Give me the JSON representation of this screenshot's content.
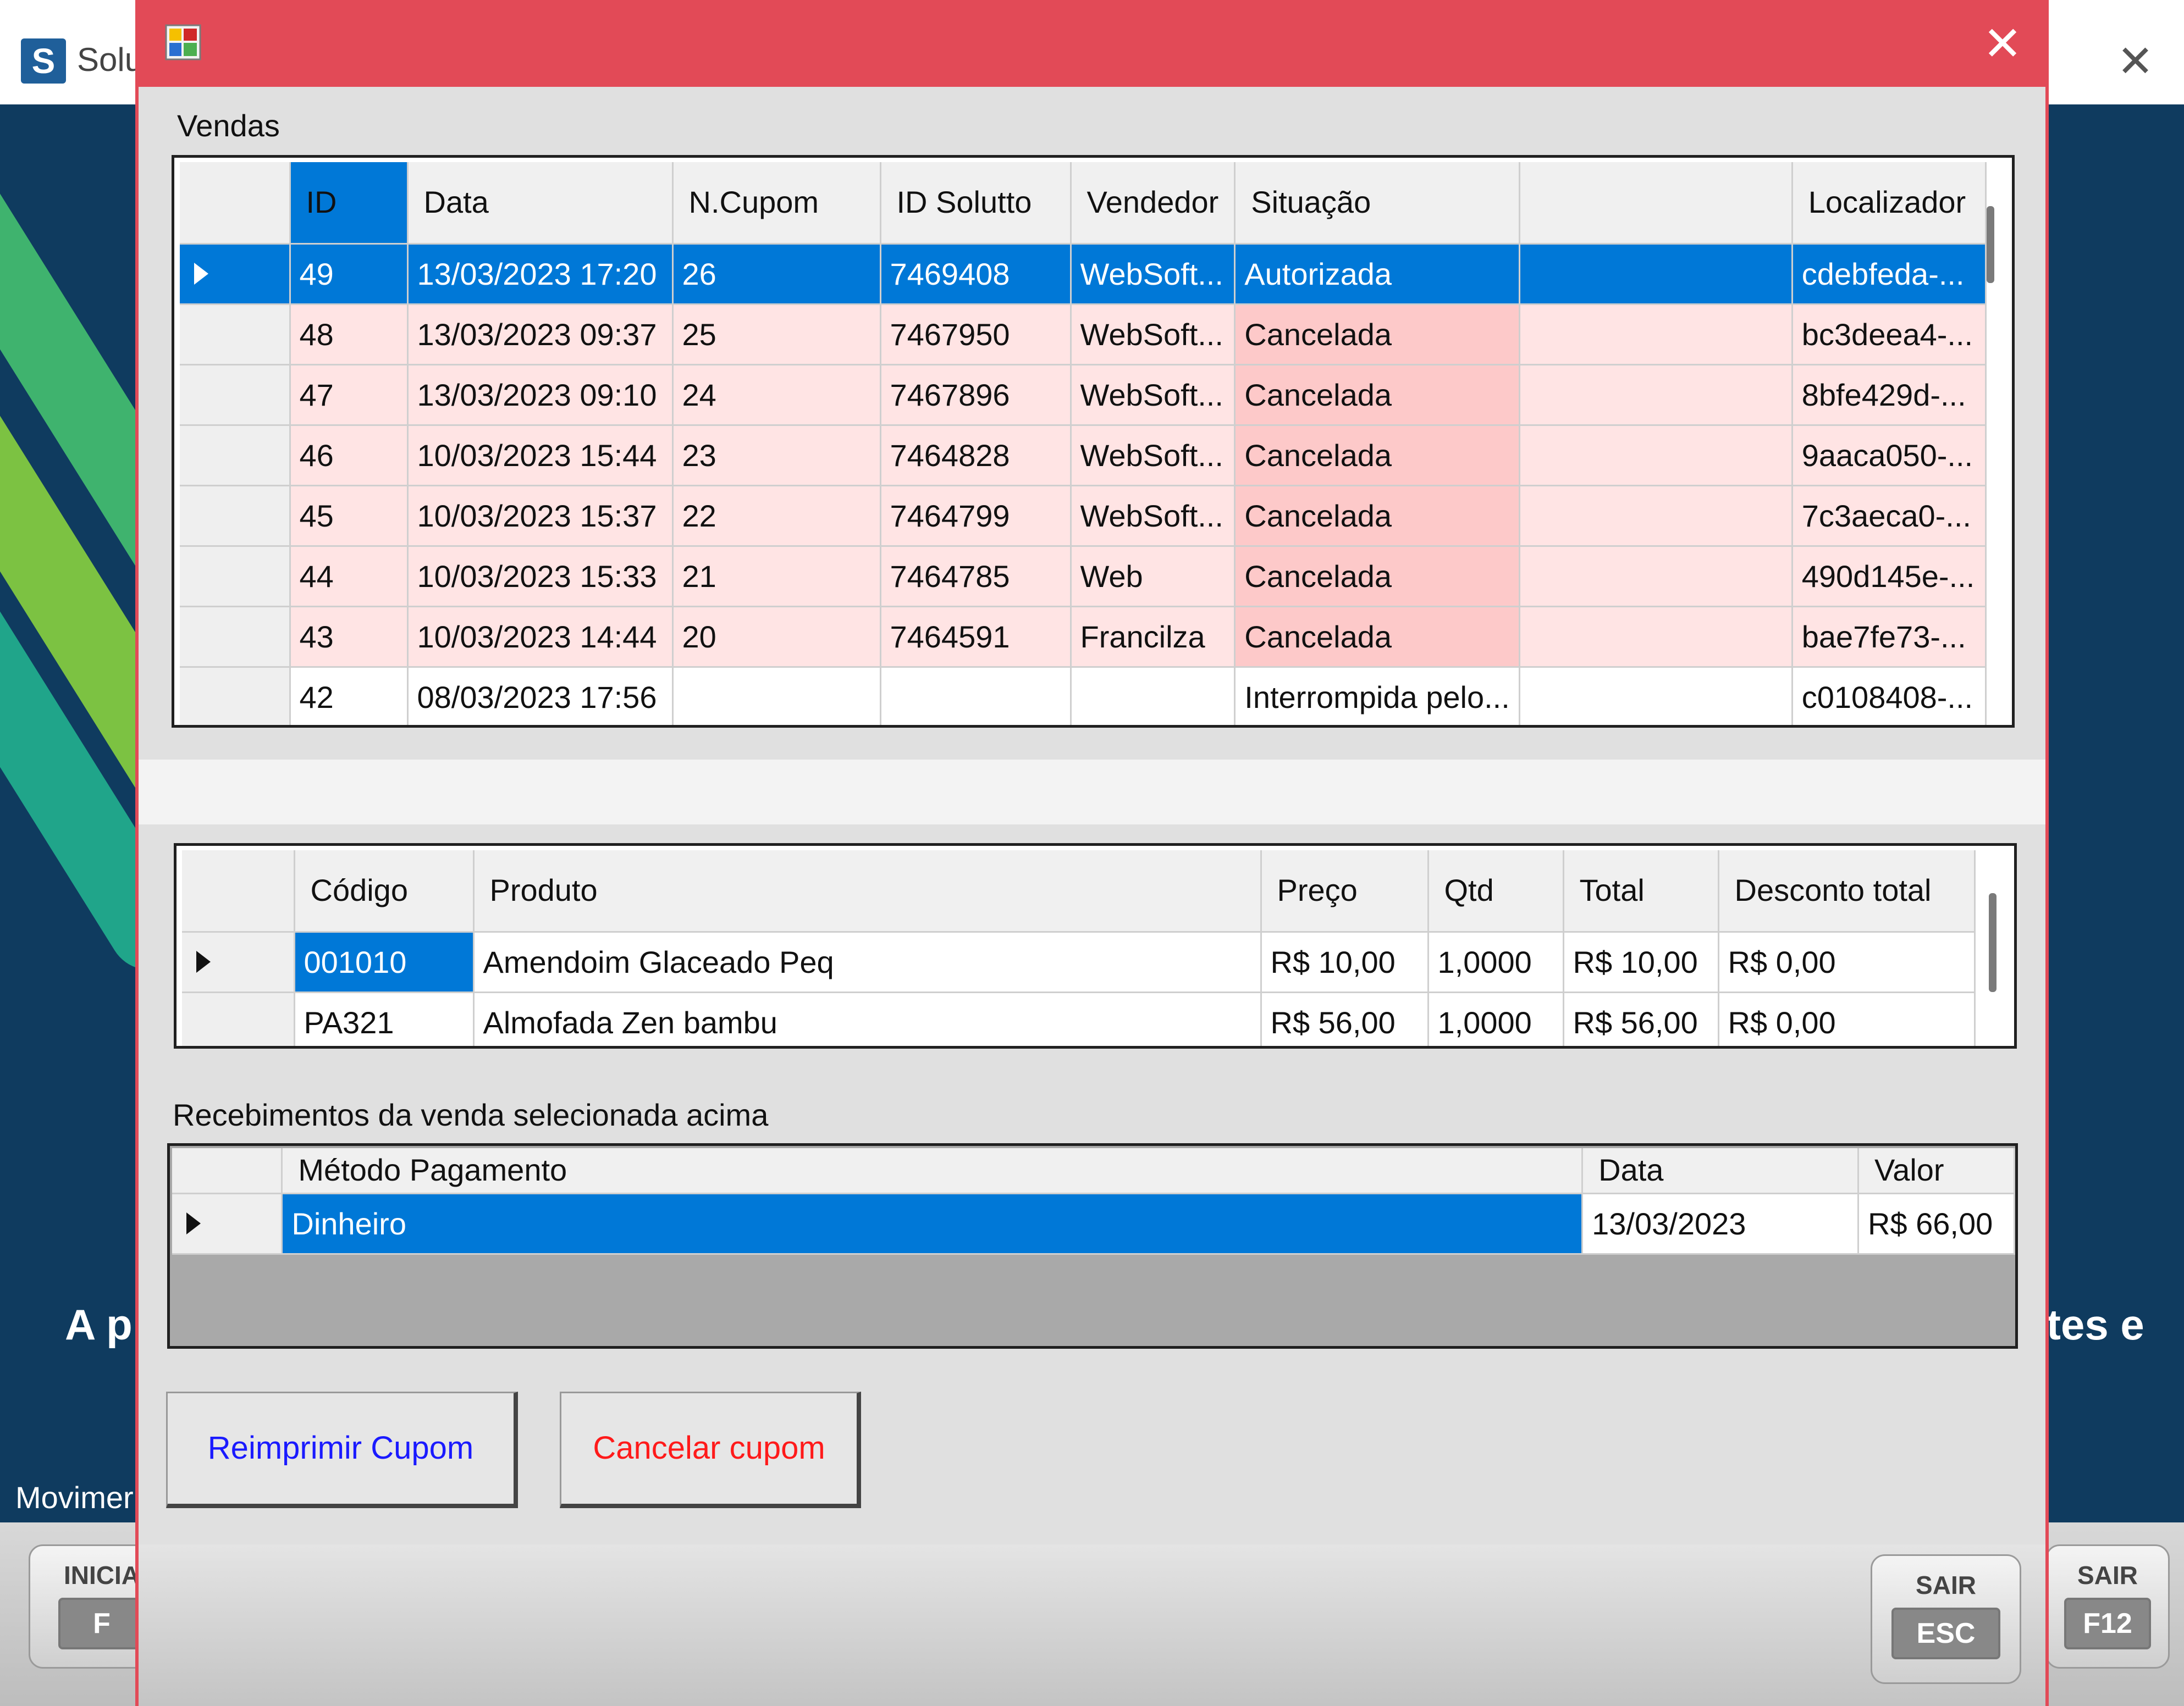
{
  "background_app": {
    "title": "Solu",
    "logo_letter": "S",
    "tagline_left": "A p",
    "tagline_right": "tes e",
    "status_label": "Movimer",
    "iniciar_label": "INICIA",
    "iniciar_key": "F",
    "sair_label": "SAIR",
    "sair_key": "F12"
  },
  "dialog": {
    "vendas_label": "Vendas",
    "vendas_grid": {
      "columns": [
        "ID",
        "Data",
        "N.Cupom",
        "ID Solutto",
        "Vendedor",
        "Situação",
        "",
        "Localizador"
      ],
      "rows": [
        {
          "id": "49",
          "data": "13/03/2023 17:20",
          "cupom": "26",
          "solutto": "7469408",
          "vendedor": "WebSoft...",
          "situacao": "Autorizada",
          "extra": "",
          "localizador": "cdebfeda-..."
        },
        {
          "id": "48",
          "data": "13/03/2023 09:37",
          "cupom": "25",
          "solutto": "7467950",
          "vendedor": "WebSoft...",
          "situacao": "Cancelada",
          "extra": "",
          "localizador": "bc3deea4-..."
        },
        {
          "id": "47",
          "data": "13/03/2023 09:10",
          "cupom": "24",
          "solutto": "7467896",
          "vendedor": "WebSoft...",
          "situacao": "Cancelada",
          "extra": "",
          "localizador": "8bfe429d-..."
        },
        {
          "id": "46",
          "data": "10/03/2023 15:44",
          "cupom": "23",
          "solutto": "7464828",
          "vendedor": "WebSoft...",
          "situacao": "Cancelada",
          "extra": "",
          "localizador": "9aaca050-..."
        },
        {
          "id": "45",
          "data": "10/03/2023 15:37",
          "cupom": "22",
          "solutto": "7464799",
          "vendedor": "WebSoft...",
          "situacao": "Cancelada",
          "extra": "",
          "localizador": "7c3aeca0-..."
        },
        {
          "id": "44",
          "data": "10/03/2023 15:33",
          "cupom": "21",
          "solutto": "7464785",
          "vendedor": "Web",
          "situacao": "Cancelada",
          "extra": "",
          "localizador": "490d145e-..."
        },
        {
          "id": "43",
          "data": "10/03/2023 14:44",
          "cupom": "20",
          "solutto": "7464591",
          "vendedor": "Francilza",
          "situacao": "Cancelada",
          "extra": "",
          "localizador": "bae7fe73-..."
        },
        {
          "id": "42",
          "data": "08/03/2023 17:56",
          "cupom": "",
          "solutto": "",
          "vendedor": "",
          "situacao": "Interrompida pelo...",
          "extra": "",
          "localizador": "c0108408-..."
        }
      ]
    },
    "itens_grid": {
      "columns": [
        "Código",
        "Produto",
        "Preço",
        "Qtd",
        "Total",
        "Desconto total"
      ],
      "rows": [
        {
          "codigo": "001010",
          "produto": "Amendoim Glaceado Peq",
          "preco": "R$ 10,00",
          "qtd": "1,0000",
          "total": "R$ 10,00",
          "desconto": "R$ 0,00"
        },
        {
          "codigo": "PA321",
          "produto": "Almofada Zen bambu",
          "preco": "R$ 56,00",
          "qtd": "1,0000",
          "total": "R$ 56,00",
          "desconto": "R$ 0,00"
        }
      ]
    },
    "recebimentos_label": "Recebimentos da venda selecionada acima",
    "recebimentos_grid": {
      "columns": [
        "Método Pagamento",
        "Data",
        "Valor"
      ],
      "rows": [
        {
          "metodo": "Dinheiro",
          "data": "13/03/2023",
          "valor": "R$ 66,00"
        }
      ]
    },
    "reimprimir_label": "Reimprimir Cupom",
    "cancelar_label": "Cancelar cupom",
    "sair_label": "SAIR",
    "sair_key": "ESC"
  },
  "colors": {
    "accent_red": "#e24a57",
    "selection_blue": "#0078d7",
    "reimprimir_text": "#1a1aff",
    "cancelar_text": "#ff1a1a",
    "cancel_row": "#ffe4e4"
  }
}
